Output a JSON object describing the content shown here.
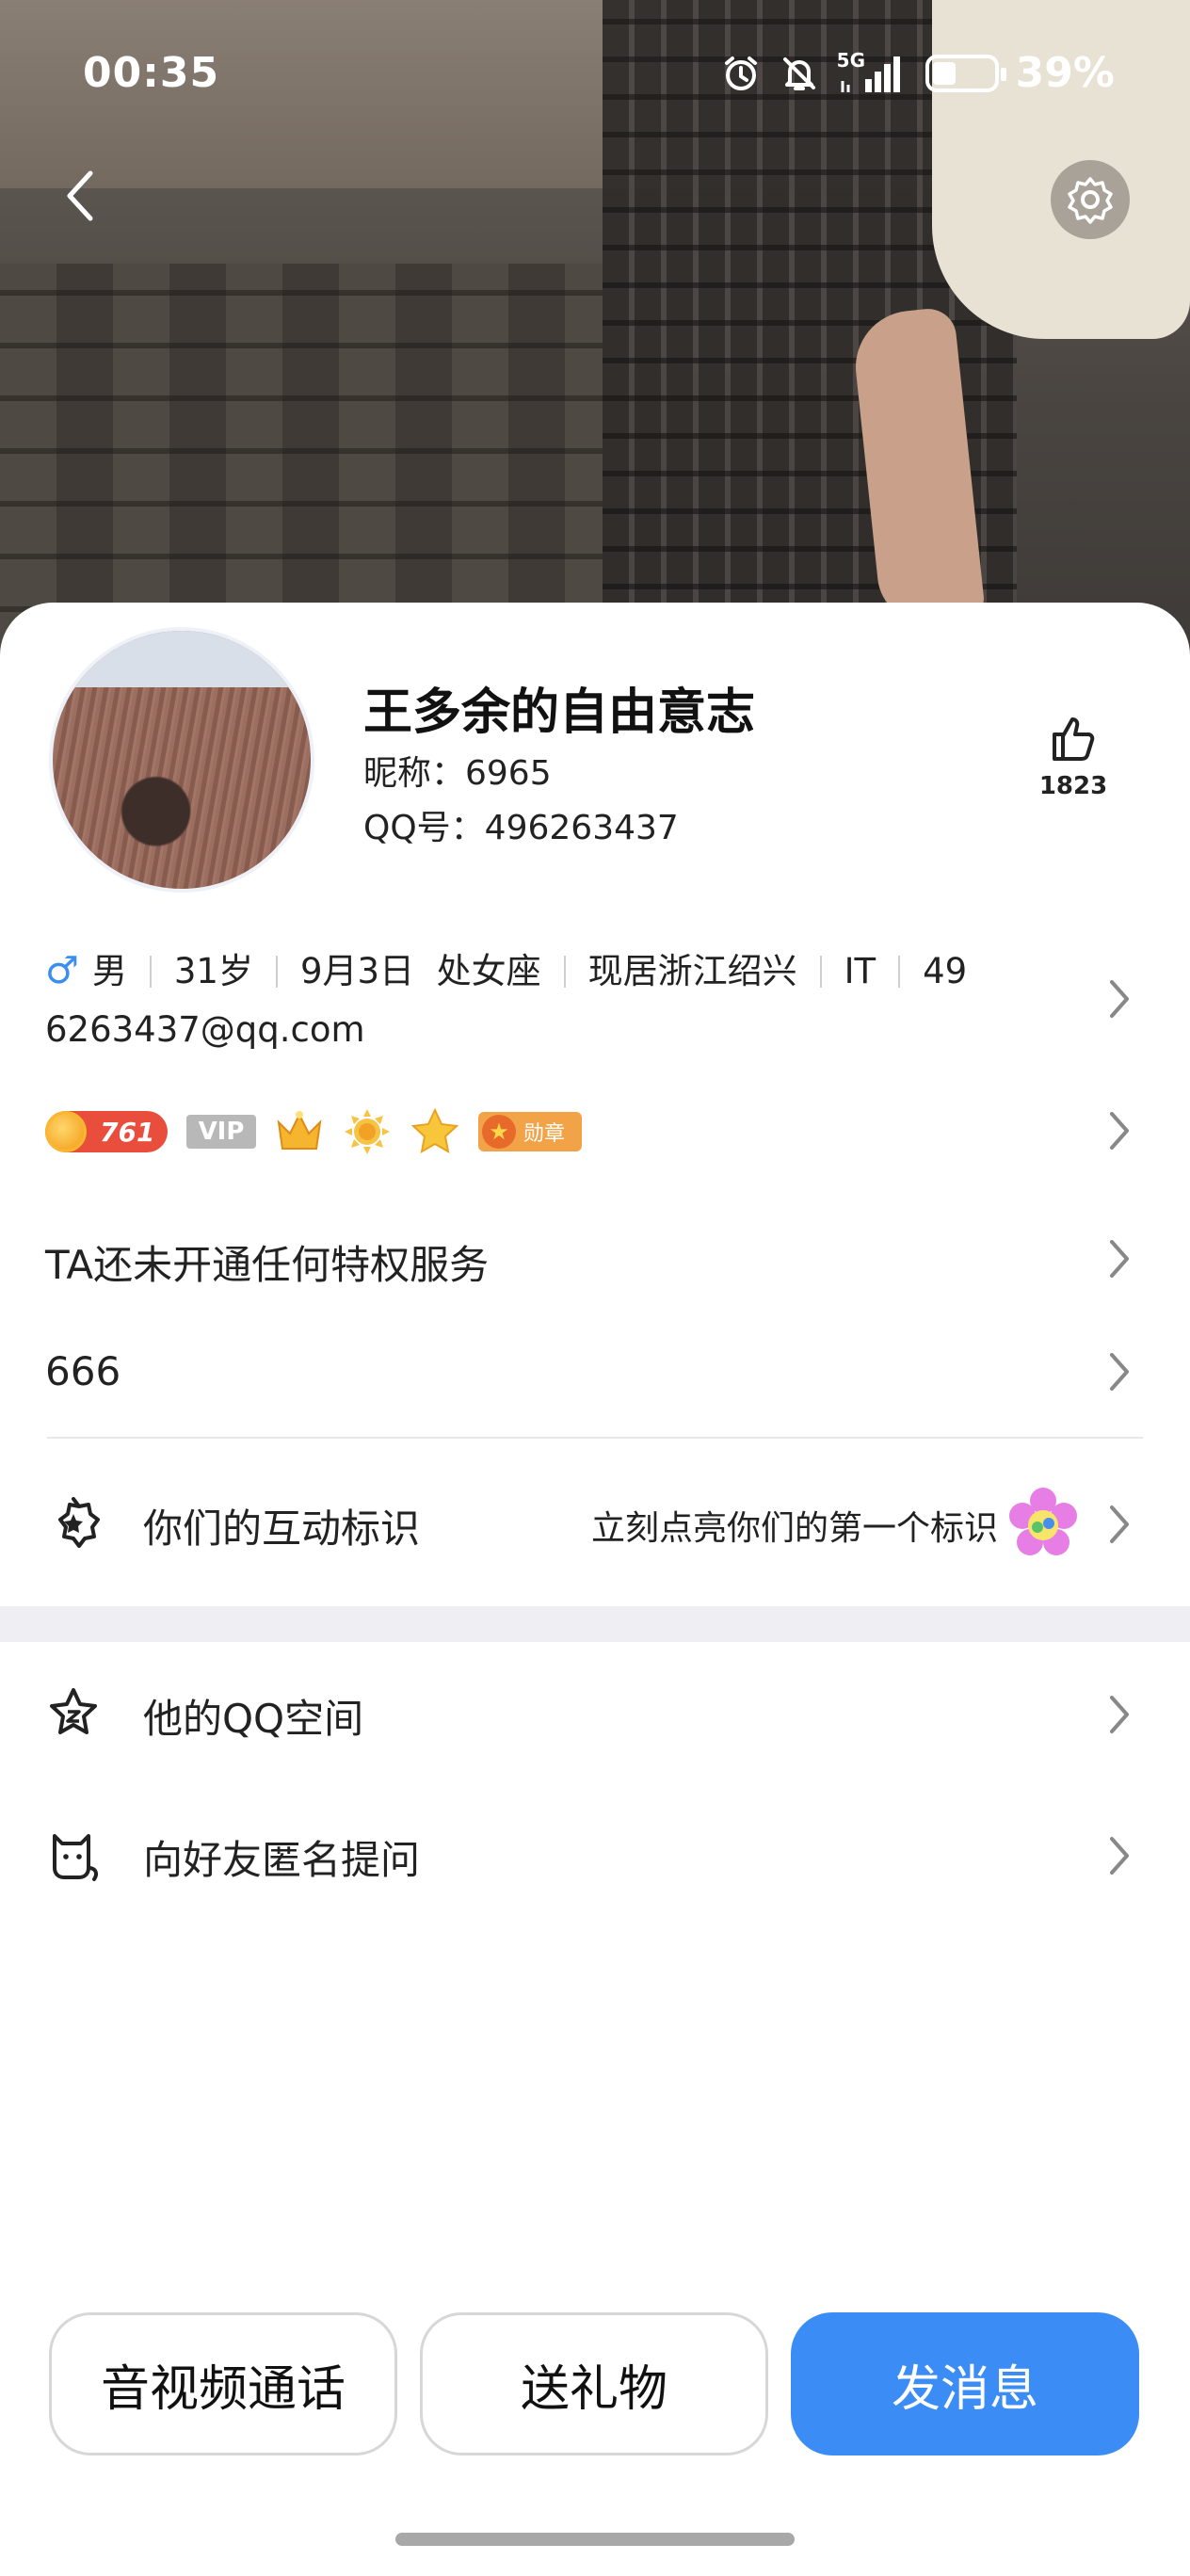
{
  "status_bar": {
    "time": "00:35",
    "network": "5G",
    "battery_pct": "39%",
    "battery_level": 0.39,
    "icons": [
      "alarm-icon",
      "mute-bell-icon",
      "signal-icon",
      "battery-icon"
    ]
  },
  "header": {
    "back_icon": "chevron-left-icon",
    "settings_icon": "gear-icon"
  },
  "profile": {
    "name": "王多余的自由意志",
    "nickname": "昵称：6965",
    "qq_number": "QQ号：496263437",
    "likes": "1823",
    "like_icon": "thumbs-up-icon"
  },
  "info": {
    "gender_symbol": "♂",
    "gender": "男",
    "age": "31岁",
    "birthday": "9月3日",
    "zodiac": "处女座",
    "location": "现居浙江绍兴",
    "industry": "IT",
    "email_line1": "49",
    "email_line2": "6263437@qq.com"
  },
  "badges": {
    "level": "761",
    "vip": "VIP",
    "medal": "勋章"
  },
  "rows": {
    "privilege": "TA还未开通任何特权服务",
    "signature": "666",
    "interaction_label": "你们的互动标识",
    "interaction_sub": "立刻点亮你们的第一个标识",
    "qzone_label": "他的QQ空间",
    "anon_label": "向好友匿名提问"
  },
  "actions": {
    "call": "音视频通话",
    "gift": "送礼物",
    "message": "发消息"
  },
  "colors": {
    "accent": "#3b8df5",
    "male": "#3a8ef0",
    "level_badge": "#e94e3c",
    "section_gap": "#efeff3"
  }
}
